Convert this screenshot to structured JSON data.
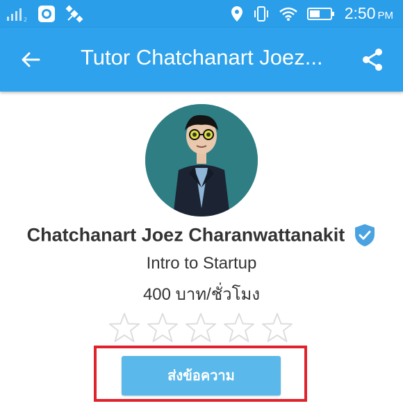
{
  "status_bar": {
    "time": "2:50",
    "ampm": "PM",
    "icons": [
      "signal-icon",
      "camera-app-icon",
      "satellite-icon",
      "location-icon",
      "vibrate-icon",
      "wifi-icon",
      "battery-icon"
    ]
  },
  "app_bar": {
    "title": "Tutor Chatchanart Joez...",
    "back_icon": "arrow-left-icon",
    "share_icon": "share-icon"
  },
  "profile": {
    "name": "Chatchanart Joez Charanwattanakit",
    "verified": true,
    "course": "Intro to Startup",
    "price": "400 บาท/ชั่วโมง",
    "rating": 0,
    "rating_max": 5
  },
  "actions": {
    "send_message_label": "ส่งข้อความ"
  },
  "colors": {
    "primary": "#2ea2ec",
    "button": "#5ab9ea",
    "highlight": "#e0232b",
    "verified": "#4aa3e0"
  }
}
